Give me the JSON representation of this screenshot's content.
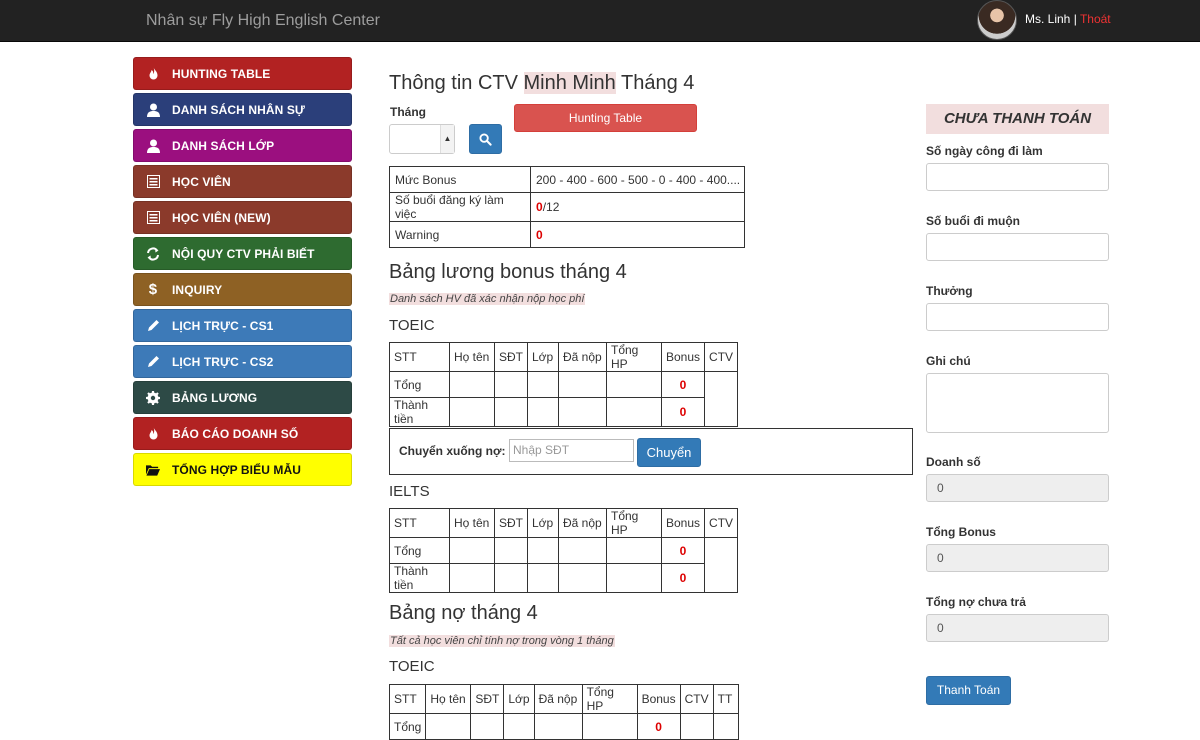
{
  "navbar": {
    "brand": "Nhân sự Fly High English Center",
    "user_name": "Ms. Linh",
    "separator": " | ",
    "logout": "Thoát"
  },
  "sidebar": {
    "items": [
      {
        "label": "HUNTING TABLE",
        "icon": "fire-icon",
        "color": "#b22222"
      },
      {
        "label": "DANH SÁCH NHÂN SỰ",
        "icon": "user-icon",
        "color": "#2b3f7a"
      },
      {
        "label": "DANH SÁCH LỚP",
        "icon": "user-icon",
        "color": "#9b0f7f"
      },
      {
        "label": "HỌC VIÊN",
        "icon": "list-icon",
        "color": "#8b3a2b"
      },
      {
        "label": "HỌC VIÊN (NEW)",
        "icon": "list-icon",
        "color": "#8b3a2b"
      },
      {
        "label": "NỘI QUY CTV PHẢI BIẾT",
        "icon": "refresh-icon",
        "color": "#2e6b30"
      },
      {
        "label": "INQUIRY",
        "icon": "dollar-icon",
        "color": "#8e6124"
      },
      {
        "label": "LỊCH TRỰC - CS1",
        "icon": "pencil-icon",
        "color": "#3d7ab8"
      },
      {
        "label": "LỊCH TRỰC - CS2",
        "icon": "pencil-icon",
        "color": "#3d7ab8"
      },
      {
        "label": "BẢNG LƯƠNG",
        "icon": "gear-icon",
        "color": "#2d4a46"
      },
      {
        "label": "BÁO CÁO DOANH SỐ",
        "icon": "fire-icon",
        "color": "#b22222"
      },
      {
        "label": "TỔNG HỢP BIỂU MẪU",
        "icon": "folder-icon",
        "color": "#ffff00"
      }
    ]
  },
  "main": {
    "title_prefix": "Thông tin CTV ",
    "title_name": "Minh Minh",
    "title_suffix": " Tháng 4",
    "month_label": "Tháng",
    "month_value": "",
    "hunting_button": "Hunting Table",
    "info": [
      {
        "label": "Mức Bonus",
        "value": "200 - 400 - 600 - 500 - 0 - 400 - 400...."
      },
      {
        "label": "Số buổi đăng ký làm việc",
        "value_red": "0",
        "value_rest": "/12"
      },
      {
        "label": "Warning",
        "value_red": "0"
      }
    ],
    "bonus_title": "Bảng lương bonus tháng 4",
    "bonus_note": "Danh sách HV đã xác nhận nộp học phí",
    "columns": [
      "STT",
      "Họ tên",
      "SĐT",
      "Lớp",
      "Đã nộp",
      "Tổng HP",
      "Bonus",
      "CTV"
    ],
    "row_total": "Tổng",
    "row_amount": "Thành tiền",
    "toeic_label": "TOEIC",
    "ielts_label": "IELTS",
    "toeic_bonus_total": "0",
    "toeic_bonus_amount": "0",
    "ielts_bonus_total": "0",
    "ielts_bonus_amount": "0",
    "transfer_label": "Chuyển xuống nợ:",
    "transfer_placeholder": "Nhập SĐT",
    "transfer_button": "Chuyển",
    "debt_title": "Bảng nợ tháng 4",
    "debt_note": "Tất cả học viên chỉ tính nợ trong vòng 1 tháng",
    "debt_toeic_label": "TOEIC",
    "debt_columns": [
      "STT",
      "Họ tên",
      "SĐT",
      "Lớp",
      "Đã nộp",
      "Tổng HP",
      "Bonus",
      "CTV",
      "TT"
    ],
    "debt_bonus_total": "0"
  },
  "right": {
    "status": "CHƯA THANH TOÁN",
    "workdays_label": "Số ngày công đi làm",
    "late_label": "Số buổi đi muộn",
    "reward_label": "Thưởng",
    "note_label": "Ghi chú",
    "revenue_label": "Doanh số",
    "revenue_value": "0",
    "bonus_total_label": "Tổng Bonus",
    "bonus_total_value": "0",
    "unpaid_debt_label": "Tổng nợ chưa trả",
    "unpaid_debt_value": "0",
    "pay_button": "Thanh Toán"
  }
}
